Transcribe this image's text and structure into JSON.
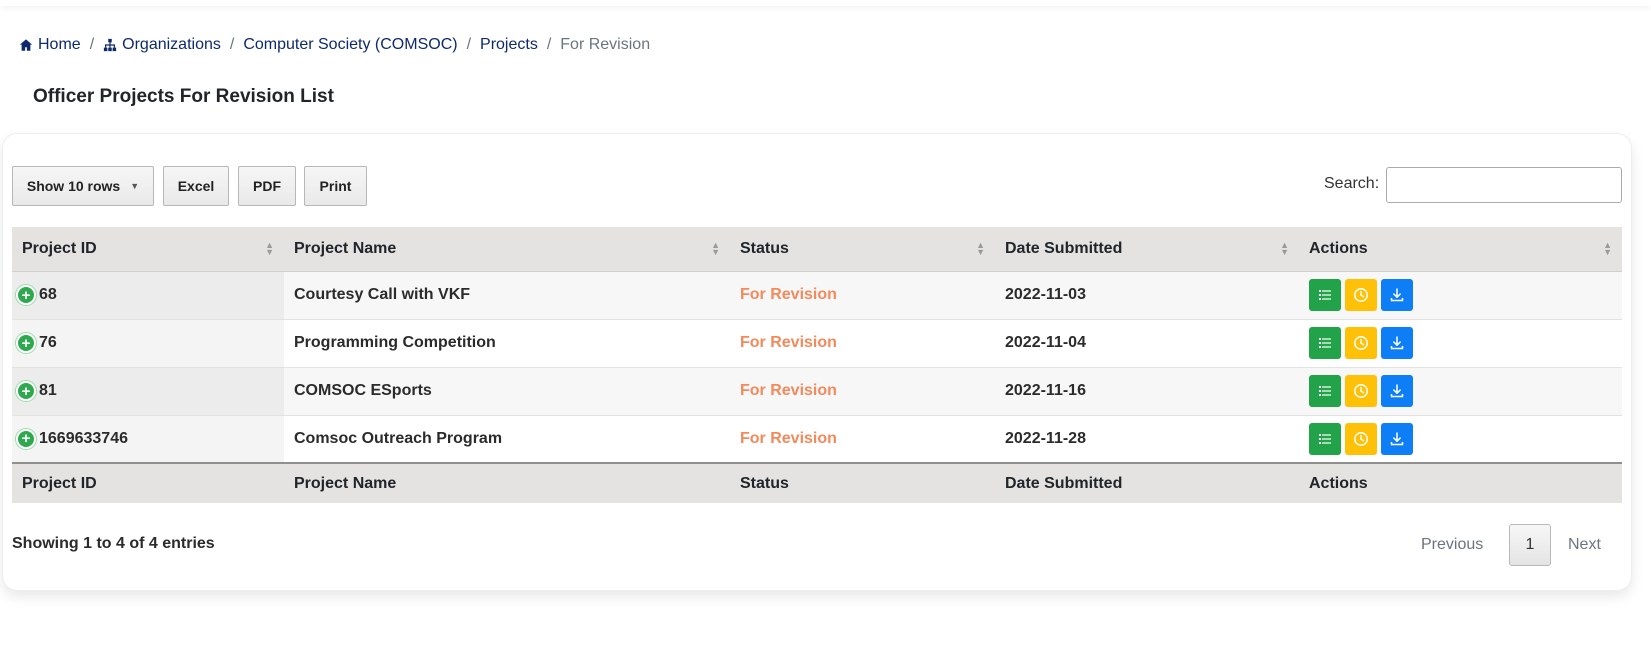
{
  "breadcrumb": {
    "home": "Home",
    "organizations": "Organizations",
    "org": "Computer Society (COMSOC)",
    "projects": "Projects",
    "current": "For Revision",
    "separator": "/"
  },
  "page_title": "Officer Projects For Revision List",
  "toolbar": {
    "show_rows": "Show 10 rows",
    "excel": "Excel",
    "pdf": "PDF",
    "print": "Print",
    "search_label": "Search:",
    "search_value": ""
  },
  "table": {
    "headers": [
      "Project ID",
      "Project Name",
      "Status",
      "Date Submitted",
      "Actions"
    ],
    "rows": [
      {
        "id": "68",
        "name": "Courtesy Call with VKF",
        "status": "For Revision",
        "date": "2022-11-03"
      },
      {
        "id": "76",
        "name": "Programming Competition",
        "status": "For Revision",
        "date": "2022-11-04"
      },
      {
        "id": "81",
        "name": "COMSOC ESports",
        "status": "For Revision",
        "date": "2022-11-16"
      },
      {
        "id": "1669633746",
        "name": "Comsoc Outreach Program",
        "status": "For Revision",
        "date": "2022-11-28"
      }
    ]
  },
  "info": "Showing 1 to 4 of 4 entries",
  "pagination": {
    "previous": "Previous",
    "page": "1",
    "next": "Next"
  },
  "colors": {
    "status": "#f28a5b",
    "green": "#22a34a",
    "yellow": "#ffc107",
    "blue": "#0d7ef5"
  },
  "icons": {
    "expand": "plus-circle-icon",
    "details": "list-icon",
    "history": "clock-icon",
    "download": "download-icon"
  }
}
